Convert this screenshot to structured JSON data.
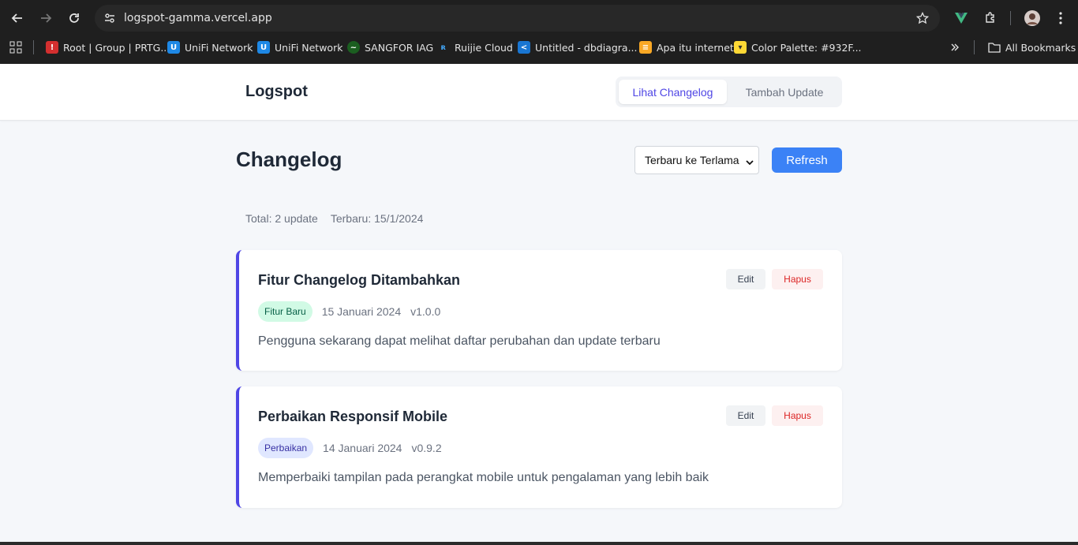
{
  "browser": {
    "url": "logspot-gamma.vercel.app",
    "bookmarks": [
      {
        "label": "Root | Group | PRTG...",
        "icon": "prtg-icon",
        "color": "#d32f2f"
      },
      {
        "label": "UniFi Network",
        "icon": "unifi-icon",
        "color": "#1e88e5"
      },
      {
        "label": "UniFi Network",
        "icon": "unifi-icon",
        "color": "#1e88e5"
      },
      {
        "label": "SANGFOR IAG",
        "icon": "sangfor-icon",
        "color": "#43a047"
      },
      {
        "label": "Ruijie Cloud",
        "icon": "ruijie-icon",
        "color": "#1565c0"
      },
      {
        "label": "Untitled - dbdiagra...",
        "icon": "dbdiagram-icon",
        "color": "#1976d2"
      },
      {
        "label": "Apa itu internet",
        "icon": "stack-icon",
        "color": "#f9a825"
      },
      {
        "label": "Color Palette: #932F...",
        "icon": "palette-icon",
        "color": "#fdd835"
      }
    ],
    "all_bookmarks": "All Bookmarks"
  },
  "app": {
    "logo": "Logspot",
    "tabs": {
      "view": "Lihat Changelog",
      "add": "Tambah Update"
    },
    "page_title": "Changelog",
    "sort": {
      "selected": "Terbaru ke Terlama"
    },
    "refresh_label": "Refresh",
    "stats": {
      "total": "Total: 2 update",
      "latest": "Terbaru: 15/1/2024"
    },
    "entries": [
      {
        "title": "Fitur Changelog Ditambahkan",
        "badge": "Fitur Baru",
        "date": "15 Januari 2024",
        "version": "v1.0.0",
        "description": "Pengguna sekarang dapat melihat daftar perubahan dan update terbaru",
        "edit": "Edit",
        "delete": "Hapus"
      },
      {
        "title": "Perbaikan Responsif Mobile",
        "badge": "Perbaikan",
        "date": "14 Januari 2024",
        "version": "v0.9.2",
        "description": "Memperbaiki tampilan pada perangkat mobile untuk pengalaman yang lebih baik",
        "edit": "Edit",
        "delete": "Hapus"
      }
    ]
  },
  "colors": {
    "accent": "#4f46e5",
    "primary_button": "#3b82f6",
    "danger": "#dc2626",
    "badge_new_bg": "#d1fae5",
    "badge_fix_bg": "#e0e7ff"
  }
}
